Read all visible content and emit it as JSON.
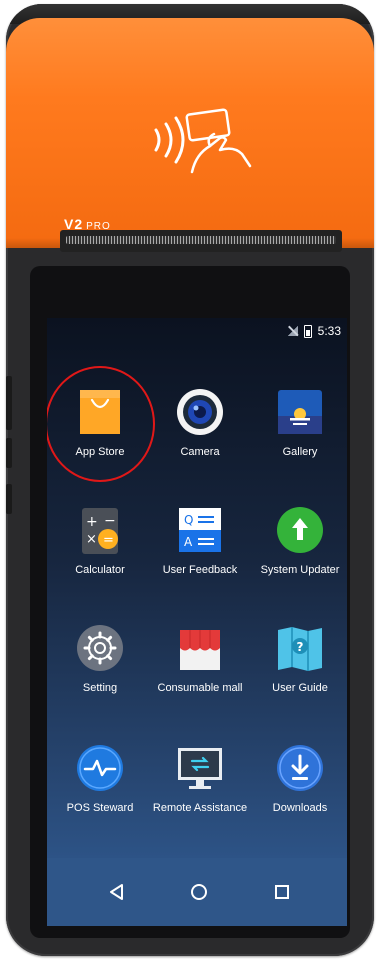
{
  "device": {
    "brand": "V2",
    "brand_sub": "PRO"
  },
  "status_bar": {
    "time": "5:33",
    "icons": [
      "no-sim-icon",
      "battery-icon"
    ]
  },
  "apps": [
    {
      "label": "App Store",
      "icon": "shopping-bag-icon",
      "color": "#ffa726",
      "highlighted": true
    },
    {
      "label": "Camera",
      "icon": "camera-icon",
      "color": "#ffffff"
    },
    {
      "label": "Gallery",
      "icon": "gallery-icon",
      "color": "#1e5bb8"
    },
    {
      "label": "Calculator",
      "icon": "calculator-icon",
      "color": "#4a4f57"
    },
    {
      "label": "User Feedback",
      "icon": "feedback-icon",
      "color": "#1a73e8"
    },
    {
      "label": "System Updater",
      "icon": "up-arrow-icon",
      "color": "#34b33a"
    },
    {
      "label": "Setting",
      "icon": "gear-icon",
      "color": "#6c7380"
    },
    {
      "label": "Consumable mall",
      "icon": "store-icon",
      "color": "#e33a3a"
    },
    {
      "label": "User Guide",
      "icon": "guide-book-icon",
      "color": "#2bb3d6"
    },
    {
      "label": "POS Steward",
      "icon": "pulse-icon",
      "color": "#1f7ae0"
    },
    {
      "label": "Remote Assistance",
      "icon": "monitor-icon",
      "color": "#2d3a4b"
    },
    {
      "label": "Downloads",
      "icon": "download-icon",
      "color": "#2f73d9"
    }
  ],
  "nav_bar": {
    "buttons": [
      "back-icon",
      "home-icon",
      "recents-icon"
    ]
  },
  "colors": {
    "device_orange": "#f77318",
    "highlight_ring": "#e01818"
  }
}
